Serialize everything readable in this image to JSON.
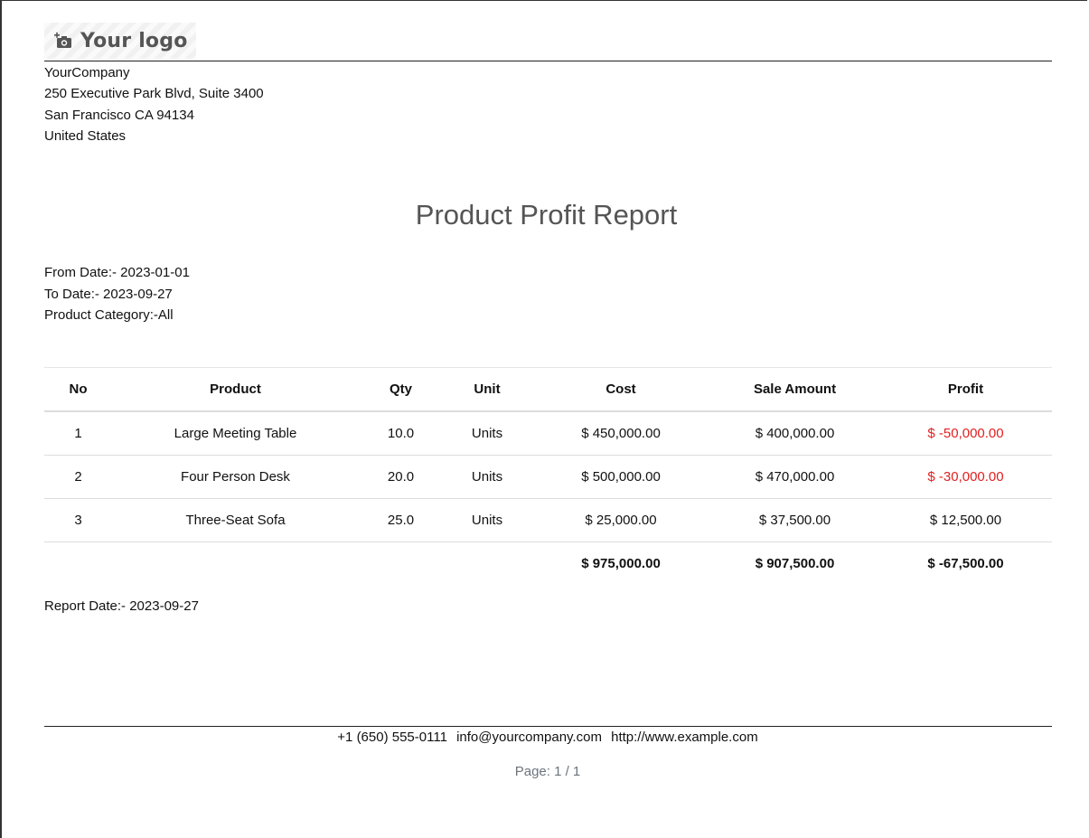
{
  "logo": {
    "text": "Your logo",
    "icon": "camera-add-icon"
  },
  "company": {
    "name": "YourCompany",
    "address_line1": "250 Executive Park Blvd, Suite 3400",
    "address_line2": "San Francisco CA 94134",
    "country": "United States"
  },
  "title": "Product Profit Report",
  "filters": {
    "from_date": "From Date:- 2023-01-01",
    "to_date": "To Date:- 2023-09-27",
    "category": "Product Category:-All"
  },
  "table": {
    "headers": [
      "No",
      "Product",
      "Qty",
      "Unit",
      "Cost",
      "Sale Amount",
      "Profit"
    ],
    "rows": [
      {
        "no": "1",
        "product": "Large Meeting Table",
        "qty": "10.0",
        "unit": "Units",
        "cost": "$ 450,000.00",
        "sale": "$ 400,000.00",
        "profit": "$ -50,000.00"
      },
      {
        "no": "2",
        "product": "Four Person Desk",
        "qty": "20.0",
        "unit": "Units",
        "cost": "$ 500,000.00",
        "sale": "$ 470,000.00",
        "profit": "$ -30,000.00"
      },
      {
        "no": "3",
        "product": "Three-Seat Sofa",
        "qty": "25.0",
        "unit": "Units",
        "cost": "$ 25,000.00",
        "sale": "$ 37,500.00",
        "profit": "$ 12,500.00"
      }
    ],
    "totals": {
      "cost": "$ 975,000.00",
      "sale": "$ 907,500.00",
      "profit": "$ -67,500.00"
    }
  },
  "report_date": "Report Date:- 2023-09-27",
  "footer": {
    "phone": "+1 (650) 555-0111",
    "email": "info@yourcompany.com",
    "website": "http://www.example.com",
    "page": "Page: 1 / 1"
  },
  "colors": {
    "negative": "#e02020",
    "title": "#555555",
    "muted": "#6c757d"
  }
}
